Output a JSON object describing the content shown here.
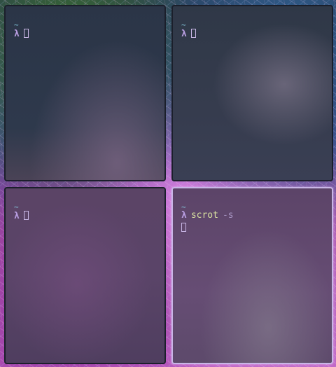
{
  "terminals": [
    {
      "id": "top-left",
      "cwd": "~",
      "prompt": "λ",
      "command": "",
      "args": ""
    },
    {
      "id": "top-right",
      "cwd": "~",
      "prompt": "λ",
      "command": "",
      "args": ""
    },
    {
      "id": "bottom-left",
      "cwd": "~",
      "prompt": "λ",
      "command": "",
      "args": ""
    },
    {
      "id": "bottom-right",
      "cwd": "~",
      "prompt": "λ",
      "command": "scrot",
      "args": "-s",
      "focused": true
    }
  ]
}
